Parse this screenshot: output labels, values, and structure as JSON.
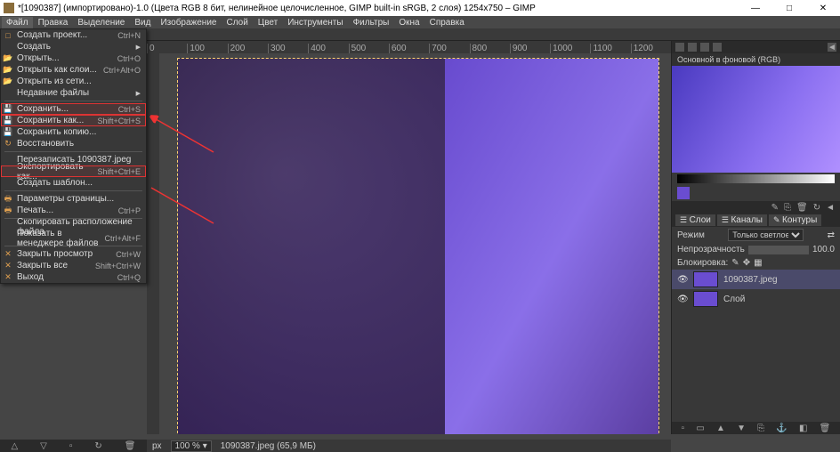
{
  "title": "*[1090387] (импортировано)-1.0 (Цвета RGB 8 бит, нелинейное целочисленное, GIMP built-in sRGB, 2 слоя) 1254x750 – GIMP",
  "menubar": [
    "Файл",
    "Правка",
    "Выделение",
    "Вид",
    "Изображение",
    "Слой",
    "Цвет",
    "Инструменты",
    "Фильтры",
    "Окна",
    "Справка"
  ],
  "dropdown": {
    "g1": [
      {
        "label": "Создать проект...",
        "sc": "Ctrl+N",
        "ic": "□"
      },
      {
        "label": "Создать",
        "sub": true
      },
      {
        "label": "Открыть...",
        "sc": "Ctrl+O",
        "ic": "📂"
      },
      {
        "label": "Открыть как слои...",
        "sc": "Ctrl+Alt+O",
        "ic": "📂"
      },
      {
        "label": "Открыть из сети...",
        "ic": "📂"
      },
      {
        "label": "Недавние файлы",
        "sub": true
      }
    ],
    "g2": [
      {
        "label": "Сохранить...",
        "sc": "Ctrl+S",
        "ic": "💾",
        "hl": true
      },
      {
        "label": "Сохранить как...",
        "sc": "Shift+Ctrl+S",
        "ic": "💾",
        "hl": true
      },
      {
        "label": "Сохранить копию...",
        "ic": "💾"
      },
      {
        "label": "Восстановить",
        "ic": "↻"
      }
    ],
    "g3": [
      {
        "label": "Перезаписать 1090387.jpeg"
      },
      {
        "label": "Экспортировать как...",
        "sc": "Shift+Ctrl+E",
        "hl": true
      },
      {
        "label": "Создать шаблон..."
      }
    ],
    "g4": [
      {
        "label": "Параметры страницы...",
        "ic": "🖶"
      },
      {
        "label": "Печать...",
        "sc": "Ctrl+P",
        "ic": "🖶"
      }
    ],
    "g5": [
      {
        "label": "Скопировать расположение файла"
      },
      {
        "label": "Показать в менеджере файлов",
        "sc": "Ctrl+Alt+F"
      }
    ],
    "g6": [
      {
        "label": "Закрыть просмотр",
        "sc": "Ctrl+W",
        "ic": "✕"
      },
      {
        "label": "Закрыть все",
        "sc": "Shift+Ctrl+W",
        "ic": "✕"
      },
      {
        "label": "Выход",
        "sc": "Ctrl+Q",
        "ic": "✕"
      }
    ]
  },
  "ruler": [
    "0",
    "100",
    "200",
    "300",
    "400",
    "500",
    "600",
    "700",
    "800",
    "900",
    "1000",
    "1100",
    "1200"
  ],
  "preview_title": "Основной в фоновой (RGB)",
  "layers": {
    "tabs": [
      "Слои",
      "Каналы",
      "Контуры"
    ],
    "mode_label": "Режим",
    "mode_value": "Только светлое",
    "opacity_label": "Непрозрачность",
    "opacity_value": "100.0",
    "lock_label": "Блокировка:",
    "items": [
      {
        "name": "1090387.jpeg"
      },
      {
        "name": "Слой"
      }
    ]
  },
  "status": {
    "unit": "px",
    "zoom": "100 %",
    "file": "1090387.jpeg (65,9 МБ)"
  }
}
